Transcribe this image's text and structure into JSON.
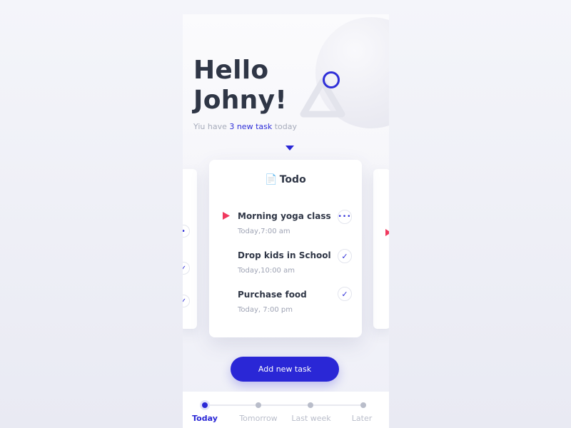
{
  "header": {
    "greeting_line1": "Hello",
    "greeting_line2": "Johny!",
    "subtitle_prefix": "Yiu have ",
    "subtitle_highlight": "3 new task",
    "subtitle_suffix": " today"
  },
  "card": {
    "title": "Todo",
    "tasks": [
      {
        "name": "Morning yoga class",
        "time": "Today,7:00 am",
        "action": "more-icon"
      },
      {
        "name": "Drop kids in School",
        "time": "Today,10:00 am",
        "action": "check-icon"
      },
      {
        "name": "Purchase food",
        "time": "Today, 7:00 pm",
        "action": "check-icon"
      }
    ]
  },
  "add_button": {
    "label": "Add new task"
  },
  "nav": {
    "items": [
      {
        "label": "Today",
        "active": true
      },
      {
        "label": "Tomorrow",
        "active": false
      },
      {
        "label": "Last week",
        "active": false
      },
      {
        "label": "Later",
        "active": false
      }
    ]
  },
  "colors": {
    "accent": "#2a27d6",
    "flag": "#f0395e",
    "text": "#2f3646",
    "muted": "#a7acbb"
  }
}
